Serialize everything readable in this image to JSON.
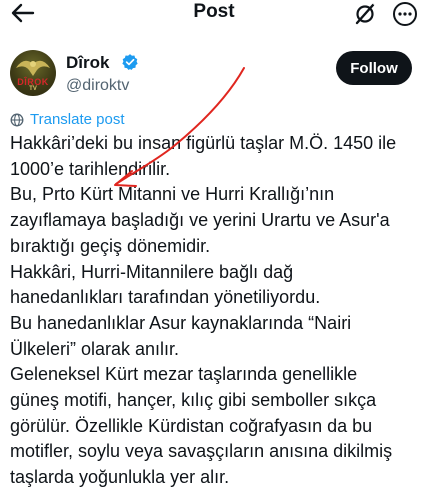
{
  "header": {
    "title": "Post",
    "back_icon": "arrow-left-icon",
    "grok_icon": "grok-icon",
    "more_icon": "more-dots-icon"
  },
  "author": {
    "avatar_text": "DÎROK",
    "avatar_subtext": "TV",
    "display_name": "Dîrok",
    "handle": "@diroktv",
    "verified": true,
    "follow_label": "Follow"
  },
  "translate": {
    "label": "Translate post",
    "icon": "translate-globe-icon"
  },
  "post": {
    "lines": [
      "Hakkâri’deki bu insan figürlü taşlar M.Ö. 1450 ile",
      "1000’e tarihlendirilir.",
      "Bu, Prto Kürt Mitanni ve Hurri Krallığı’nın",
      "zayıflamaya başladığı ve  yerini Urartu ve Asur'a",
      "bıraktığı geçiş dönemidir.",
      "Hakkâri,  Hurri-Mitannilere bağlı dağ",
      "hanedanlıkları tarafından yönetiliyordu.",
      "Bu hanedanlıklar Asur kaynaklarında “Nairi",
      "Ülkeleri” olarak anılır.",
      "Geleneksel Kürt mezar taşlarında genellikle",
      "güneş motifi, hançer, kılıç gibi semboller sıkça",
      "görülür. Özellikle Kürdistan coğrafyasın da bu",
      "motifler, soylu veya savaşçıların  anısına dikilmiş",
      "taşlarda yoğunlukla yer alır."
    ]
  },
  "colors": {
    "accent": "#1d9bf0",
    "text": "#0f1419",
    "muted": "#536471",
    "annotation": "#e0261f"
  }
}
